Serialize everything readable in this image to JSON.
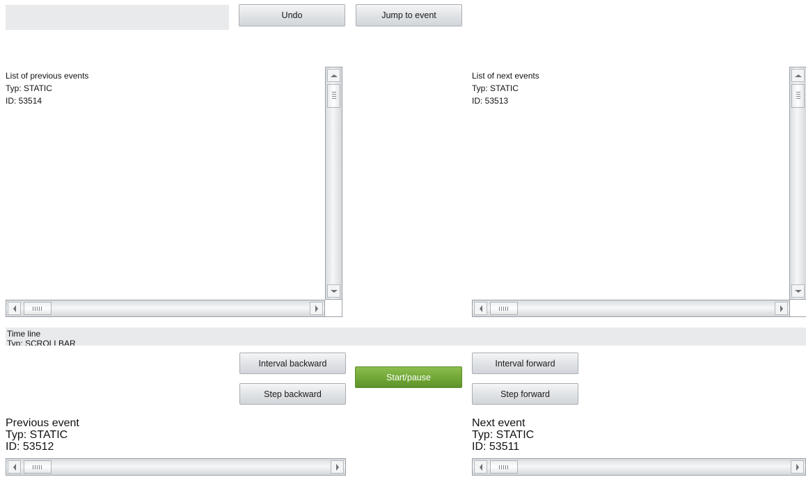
{
  "toolbar": {
    "undo_label": "Undo",
    "jump_label": "Jump to event"
  },
  "left_panel": {
    "title": "List of previous events",
    "type": "Typ: STATIC",
    "id": "ID: 53514"
  },
  "right_panel": {
    "title": "List of next events",
    "type": "Typ: STATIC",
    "id": "ID: 53513"
  },
  "timeline": {
    "title": "Time line",
    "type": "Typ: SCROLLBAR"
  },
  "controls": {
    "interval_backward": "Interval backward",
    "step_backward": "Step backward",
    "start_pause": "Start/pause",
    "interval_forward": "Interval forward",
    "step_forward": "Step forward"
  },
  "previous_event": {
    "title": "Previous event",
    "type": "Typ: STATIC",
    "id": "ID: 53512"
  },
  "next_event": {
    "title": "Next event",
    "type": "Typ: STATIC",
    "id": "ID: 53511"
  },
  "colors": {
    "start_button": "#6ea534",
    "field_background": "#e9eaec"
  }
}
